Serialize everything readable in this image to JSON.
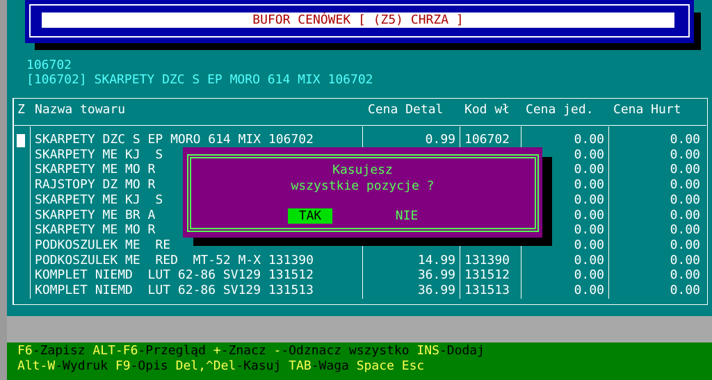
{
  "title": "BUFOR CENÓWEK [ (Z5) CHRZA ]",
  "info": {
    "code": "106702",
    "product_line": "[106702] SKARPETY DZC S EP MORO 614 MIX 106702"
  },
  "table": {
    "headers": {
      "z": "Z",
      "name": "Nazwa towaru",
      "price_retail": "Cena Detal",
      "code_own": "Kod wł",
      "price_unit": "Cena jed.",
      "price_wholesale": "Cena Hurt"
    },
    "rows": [
      {
        "name": "SKARPETY DZC S EP MORO 614 MIX 106702",
        "price": "0.99",
        "code": "106702",
        "unit": "0.00",
        "hurt": "0.00"
      },
      {
        "name": "SKARPETY ME KJ  S",
        "price": "",
        "code": "",
        "unit": "0.00",
        "hurt": "0.00"
      },
      {
        "name": "SKARPETY ME MO R",
        "price": "",
        "code": "",
        "unit": "0.00",
        "hurt": "0.00"
      },
      {
        "name": "RAJSTOPY DZ MO R",
        "price": "",
        "code": "",
        "unit": "0.00",
        "hurt": "0.00"
      },
      {
        "name": "SKARPETY ME KJ  S",
        "price": "",
        "code": "",
        "unit": "0.00",
        "hurt": "0.00"
      },
      {
        "name": "SKARPETY ME BR A",
        "price": "",
        "code": "",
        "unit": "0.00",
        "hurt": "0.00"
      },
      {
        "name": "SKARPETY ME MO R",
        "price": "",
        "code": "",
        "unit": "0.00",
        "hurt": "0.00"
      },
      {
        "name": "PODKOSZULEK ME  RE",
        "price": "",
        "code": "",
        "unit": "0.00",
        "hurt": "0.00"
      },
      {
        "name": "PODKOSZULEK ME  RED  MT-52 M-X 131390",
        "price": "14.99",
        "code": "131390",
        "unit": "0.00",
        "hurt": "0.00"
      },
      {
        "name": "KOMPLET NIEMD  LUT 62-86 SV129 131512",
        "price": "36.99",
        "code": "131512",
        "unit": "0.00",
        "hurt": "0.00"
      },
      {
        "name": "KOMPLET NIEMD  LUT 62-86 SV129 131513",
        "price": "36.99",
        "code": "131513",
        "unit": "0.00",
        "hurt": "0.00"
      }
    ]
  },
  "dialog": {
    "line1": "Kasujesz",
    "line2": "wszystkie pozycje ?",
    "yes": "TAK",
    "no": "NIE"
  },
  "footer": {
    "line1": [
      {
        "key": "F6",
        "label": "-Zapisz "
      },
      {
        "key": "ALT-F6",
        "label": "-Przegląd "
      },
      {
        "key": "+",
        "label": "-Znacz "
      },
      {
        "key": "-",
        "label": "-Odznacz wszystko "
      },
      {
        "key": "INS",
        "label": "-Dodaj"
      }
    ],
    "line2": [
      {
        "key": "Alt-W",
        "label": "-Wydruk "
      },
      {
        "key": "F9",
        "label": "-Opis "
      },
      {
        "key": "Del,^Del",
        "label": "-Kasuj "
      },
      {
        "key": "TAB",
        "label": "-Waga "
      },
      {
        "key": "Space Esc",
        "label": ""
      }
    ]
  },
  "colors": {
    "background": "#008080",
    "title_bg": "#0000a8",
    "dialog_bg": "#800080",
    "accent_green": "#55ff55",
    "footer_bg": "#008000",
    "footer_key": "#ffff55"
  }
}
